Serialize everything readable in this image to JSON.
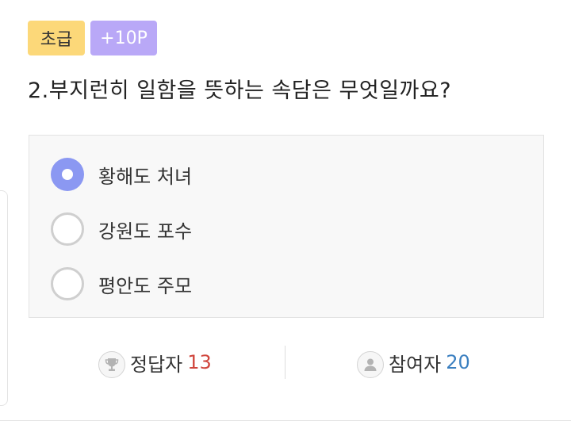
{
  "quiz": {
    "level_badge": "초급",
    "points_badge": "+10P",
    "question": "2.부지런히 일함을 뜻하는 속담은 무엇일까요?",
    "options": [
      {
        "label": "황해도 처녀",
        "selected": true
      },
      {
        "label": "강원도 포수",
        "selected": false
      },
      {
        "label": "평안도 주모",
        "selected": false
      }
    ],
    "colors": {
      "level_badge": "#fcd879",
      "points_badge": "#b9a8f7",
      "selected_radio": "#8b98f2",
      "correct_count": "#d0453c",
      "participant_count": "#3a7fc0"
    }
  },
  "stats": {
    "correct_label": "정답자",
    "correct_count": "13",
    "correct_icon": "trophy-icon",
    "participants_label": "참여자",
    "participants_count": "20",
    "participants_icon": "user-icon"
  }
}
